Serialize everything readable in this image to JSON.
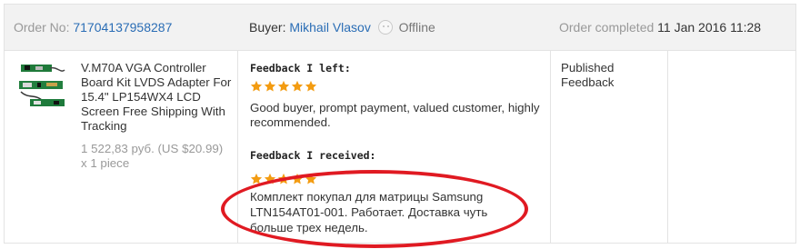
{
  "header": {
    "order_label": "Order No:",
    "order_number": "71704137958287",
    "buyer_label": "Buyer:",
    "buyer_name": "Mikhail Vlasov",
    "buyer_status": "Offline",
    "completed_label": "Order completed",
    "completed_date": "11 Jan 2016 11:28"
  },
  "product": {
    "title": "V.M70A VGA Controller Board Kit LVDS Adapter For 15.4\" LP154WX4 LCD Screen Free Shipping With Tracking",
    "price": "1 522,83 руб. (US $20.99)",
    "quantity": "x 1 piece"
  },
  "feedback_left": {
    "heading": "Feedback I left:",
    "rating": 5,
    "text": "Good buyer, prompt payment, valued customer, highly recommended."
  },
  "feedback_received": {
    "heading": "Feedback I received:",
    "rating": 5,
    "text": "Комплект покупал для матрицы Samsung LTN154AT01-001. Работает. Доставка чуть больше трех недель."
  },
  "status": {
    "text": "Published Feedback"
  },
  "colors": {
    "star": "#f39c12",
    "link": "#2a6db5",
    "highlight_ellipse": "#e01a22"
  }
}
